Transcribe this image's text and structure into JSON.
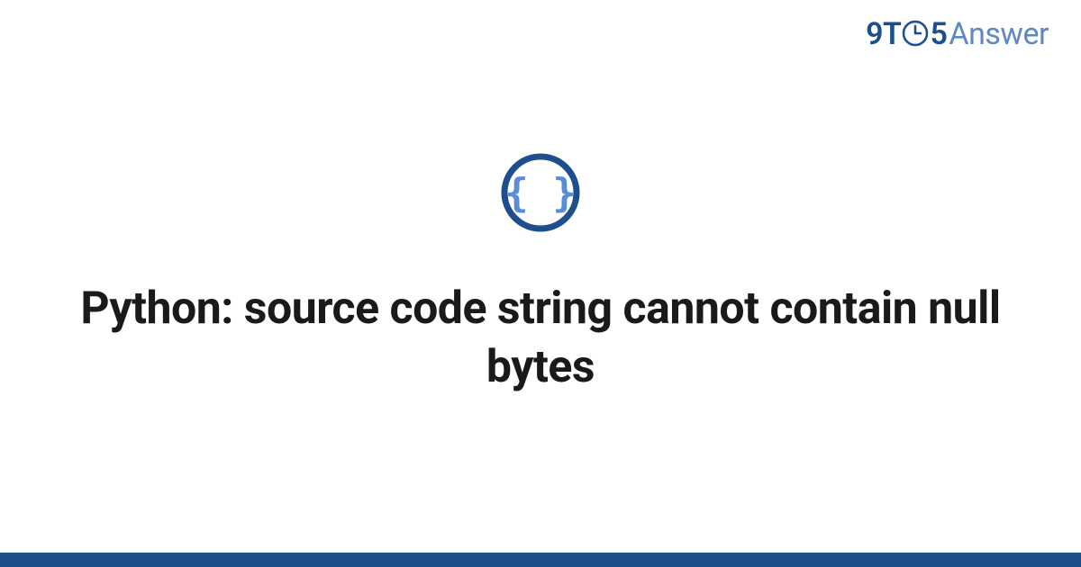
{
  "logo": {
    "part1": "9T",
    "part2": "5",
    "part3": "Answer"
  },
  "title": "Python: source code string cannot contain null bytes",
  "colors": {
    "brand_dark": "#1e4e8c",
    "brand_light": "#5f88c4",
    "icon_inner": "#5a8dd6",
    "text": "#1a1a1a"
  },
  "icon": {
    "name": "curly-braces-icon"
  }
}
